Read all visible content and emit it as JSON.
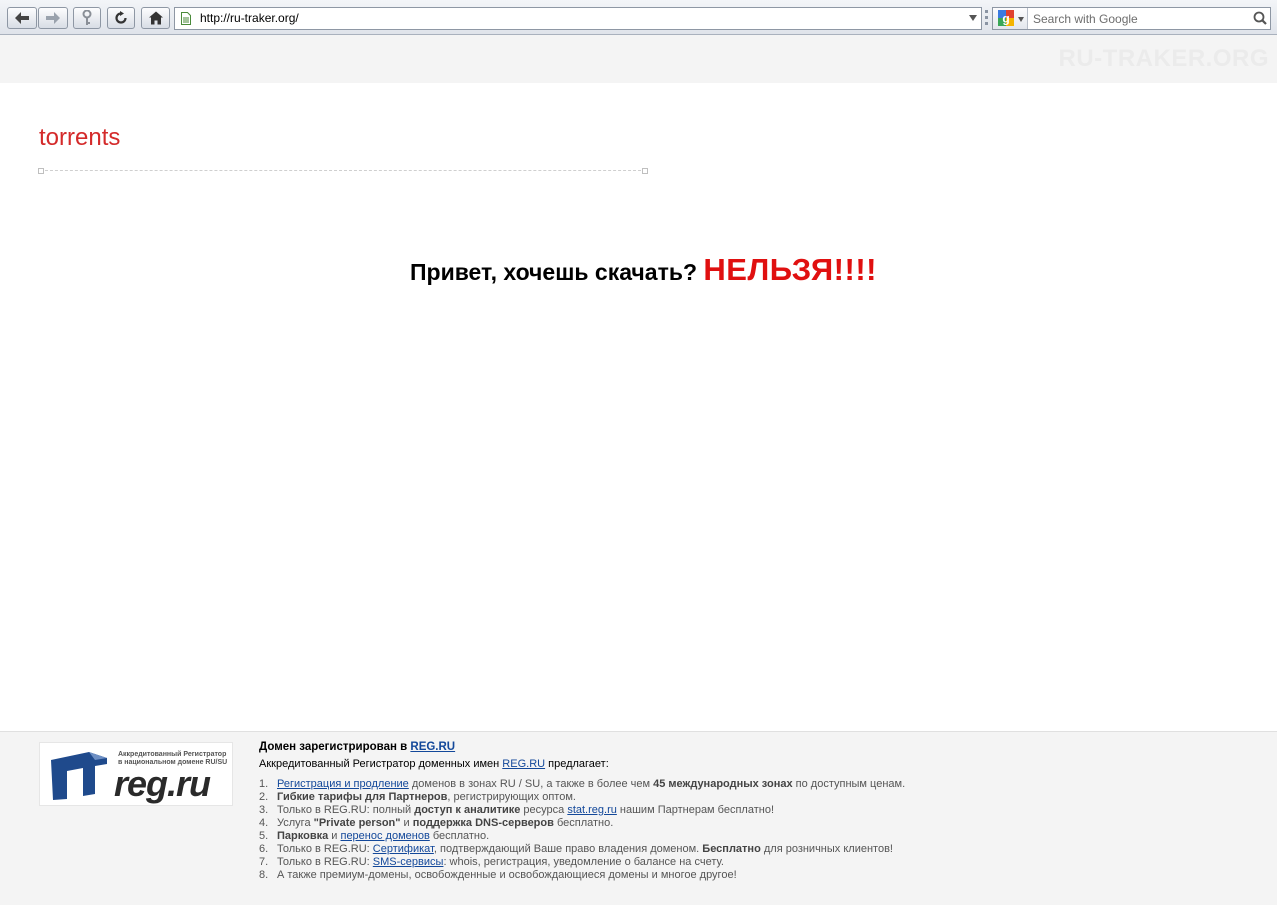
{
  "browser": {
    "url": "http://ru-traker.org/",
    "search_placeholder": "Search with Google"
  },
  "page": {
    "watermark": "RU-TRAKER.ORG",
    "site_title": "torrents",
    "headline_text": "Привет, хочешь скачать? ",
    "headline_emphasis": "НЕЛЬЗЯ!!!!",
    "colors": {
      "title": "#d42a2a",
      "emphasis": "#e01010",
      "link": "#13489a"
    }
  },
  "footer": {
    "logo_caption_1": "Аккредитованный Регистратор",
    "logo_caption_2": "в национальном домене RU/SU",
    "logo_brand": "reg.ru",
    "heading_prefix": "Домен зарегистрирован в ",
    "heading_link": "REG.RU",
    "subheading_prefix": "Аккредитованный Регистратор доменных имен ",
    "subheading_link": "REG.RU",
    "subheading_suffix": " предлагает:",
    "items": [
      {
        "num": "1.",
        "link": "Регистрация и продление",
        "text1": " доменов в зонах RU / SU, а также в более чем ",
        "bold": "45 международных зонах",
        "text2": " по доступным ценам."
      },
      {
        "num": "2.",
        "bold": "Гибкие тарифы для Партнеров",
        "text1": ", регистрирующих оптом."
      },
      {
        "num": "3.",
        "text1": "Только в REG.RU: полный ",
        "bold": "доступ к аналитике",
        "text2": " ресурса ",
        "link": "stat.reg.ru",
        "text3": " нашим Партнерам бесплатно!"
      },
      {
        "num": "4.",
        "text1": "Услуга ",
        "bold": "\"Private person\"",
        "text2": " и ",
        "bold2": "поддержка DNS-серверов",
        "text3": " бесплатно."
      },
      {
        "num": "5.",
        "bold": "Парковка",
        "text1": " и ",
        "link": "перенос доменов",
        "text2": " бесплатно."
      },
      {
        "num": "6.",
        "text1": "Только в REG.RU: ",
        "link": "Сертификат",
        "text2": ", подтверждающий Ваше право владения доменом. ",
        "bold": "Бесплатно",
        "text3": " для розничных клиентов!"
      },
      {
        "num": "7.",
        "text1": "Только в REG.RU: ",
        "link": "SMS-сервисы",
        "text2": ": whois, регистрация, уведомление о балансе на счету."
      },
      {
        "num": "8.",
        "text1": "А также премиум-домены, освобожденные и освобождающиеся домены и многое другое!"
      }
    ]
  }
}
